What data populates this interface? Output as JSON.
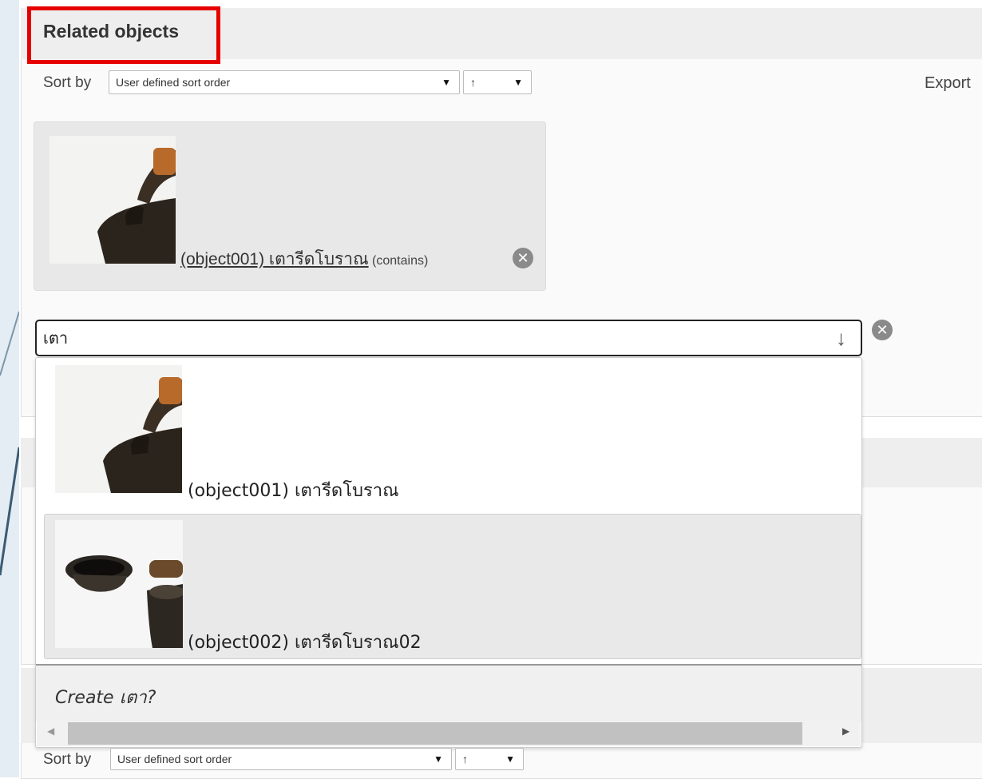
{
  "section": {
    "title": "Related objects",
    "export_label": "Export"
  },
  "sort": {
    "label": "Sort by",
    "order_value": "User defined sort order",
    "direction_value": "↑"
  },
  "related_item": {
    "link_text": "(object001) เตารีดโบราณ",
    "relation": "(contains)"
  },
  "search": {
    "value": "เตา"
  },
  "options": [
    {
      "label": "(object001) เตารีดโบราณ"
    },
    {
      "label": "(object002) เตารีดโบราณ02"
    }
  ],
  "create_label": "Create เตา?",
  "bottom_sort": {
    "label": "Sort by",
    "order_value": "User defined sort order",
    "direction_value": "↑"
  },
  "icons": {
    "remove": "x-circle-icon",
    "dropdown": "chevron-down-icon",
    "scroll_left": "scroll-left-icon",
    "scroll_right": "scroll-right-icon"
  },
  "colors": {
    "highlight_border": "#e60000",
    "header_bg": "#eeeeee",
    "card_bg": "#e8e8e8",
    "hover_row": "#e9e9e9"
  }
}
